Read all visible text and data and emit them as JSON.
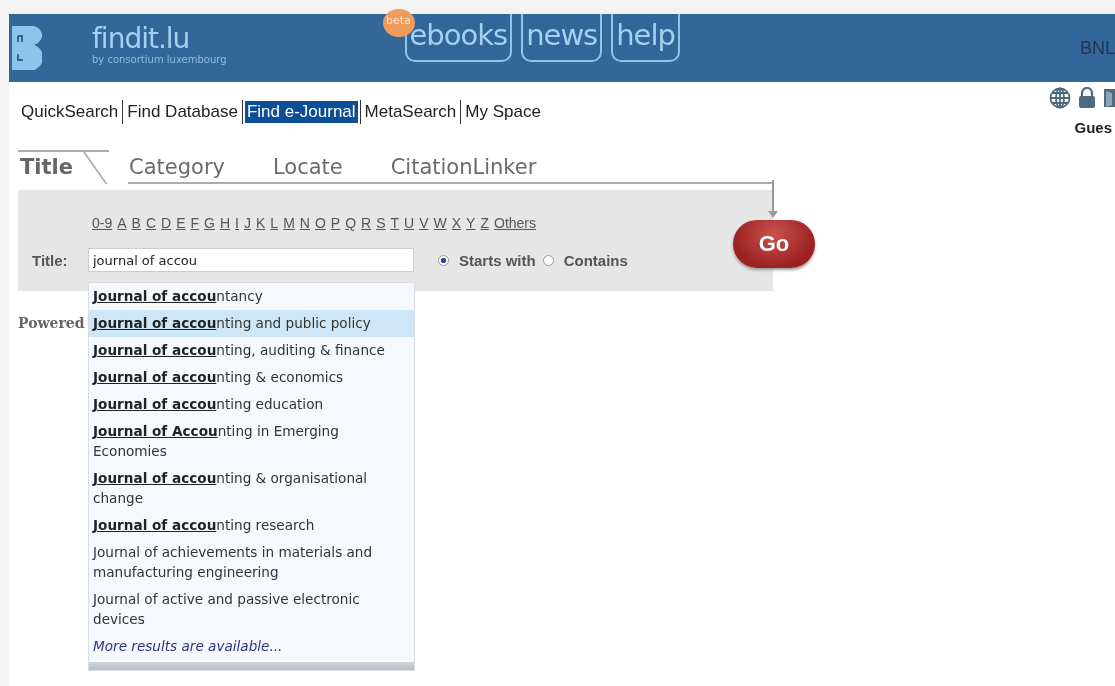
{
  "header": {
    "logo": "findit.lu",
    "tagline": "by consortium luxembourg",
    "badge": "beta",
    "links": [
      {
        "label": "ebooks"
      },
      {
        "label": "news"
      },
      {
        "label": "help"
      }
    ],
    "institution": "BNL"
  },
  "nav": [
    {
      "label": "QuickSearch",
      "selected": false
    },
    {
      "label": "Find Database",
      "selected": false
    },
    {
      "label": "Find e-Journal",
      "selected": true
    },
    {
      "label": "MetaSearch",
      "selected": false
    },
    {
      "label": "My Space",
      "selected": false
    }
  ],
  "user": "Gues",
  "search_tabs": [
    {
      "label": "Title",
      "selected": true
    },
    {
      "label": "Category",
      "selected": false
    },
    {
      "label": "Locate",
      "selected": false
    },
    {
      "label": "CitationLinker",
      "selected": false
    }
  ],
  "alphabet": [
    "0-9",
    "A",
    "B",
    "C",
    "D",
    "E",
    "F",
    "G",
    "H",
    "I",
    "J",
    "K",
    "L",
    "M",
    "N",
    "O",
    "P",
    "Q",
    "R",
    "S",
    "T",
    "U",
    "V",
    "W",
    "X",
    "Y",
    "Z",
    "Others"
  ],
  "title_field": {
    "label": "Title:",
    "value": "journal of accou"
  },
  "match_options": [
    {
      "label": "Starts with",
      "selected": true
    },
    {
      "label": "Contains",
      "selected": false
    }
  ],
  "go_button": "Go",
  "powered": "Powered",
  "suggestions": [
    {
      "text": "**Journal of accou**ntancy",
      "selected": false
    },
    {
      "text": "**Journal of accou**nting and public policy",
      "selected": true
    },
    {
      "text": "**Journal of accou**nting, auditing & finance",
      "selected": false
    },
    {
      "text": "**Journal of accou**nting & economics",
      "selected": false
    },
    {
      "text": "**Journal of accou**nting education",
      "selected": false
    },
    {
      "text": "**Journal of Accou**nting in Emerging Economies",
      "selected": false
    },
    {
      "text": "**Journal of accou**nting & organisational change",
      "selected": false
    },
    {
      "text": "**Journal of accou**nting research",
      "selected": false
    },
    {
      "text": "Journal of achievements in materials and manufacturing engineering",
      "selected": false
    },
    {
      "text": "Journal of active and passive electronic devices",
      "selected": false
    }
  ],
  "more_results": "More results are available..."
}
